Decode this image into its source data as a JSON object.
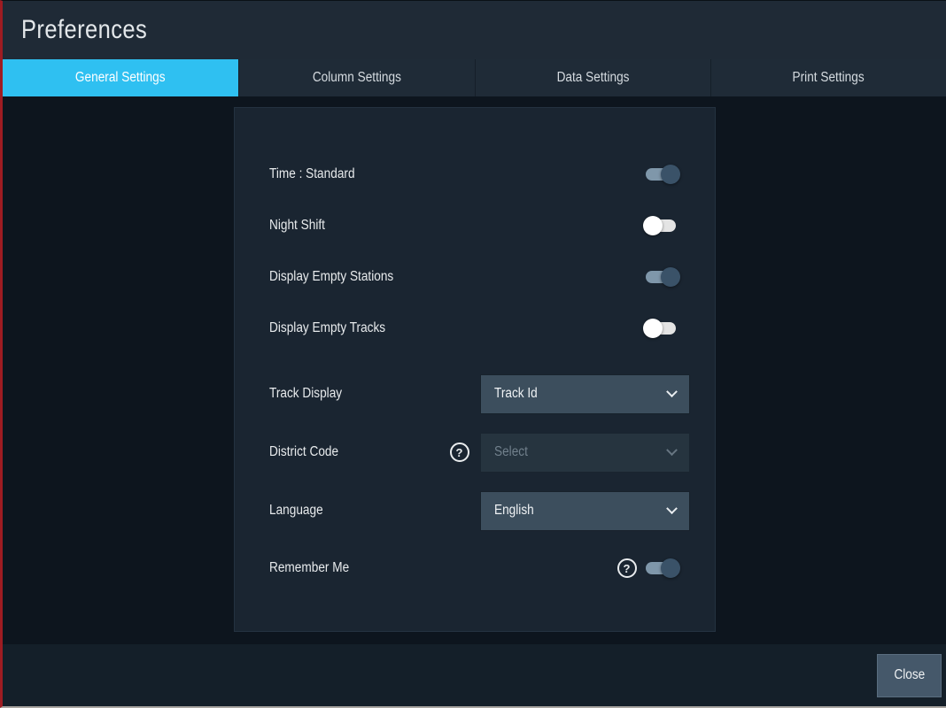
{
  "window": {
    "title": "Preferences"
  },
  "tabs": [
    {
      "label": "General Settings",
      "active": true
    },
    {
      "label": "Column Settings",
      "active": false
    },
    {
      "label": "Data Settings",
      "active": false
    },
    {
      "label": "Print Settings",
      "active": false
    }
  ],
  "settings": {
    "toggles": [
      {
        "label": "Time : Standard",
        "on": true
      },
      {
        "label": "Night Shift",
        "on": false
      },
      {
        "label": "Display Empty Stations",
        "on": true
      },
      {
        "label": "Display Empty Tracks",
        "on": false
      }
    ],
    "dropdowns": [
      {
        "label": "Track Display",
        "value": "Track Id",
        "disabled": false,
        "help": false
      },
      {
        "label": "District Code",
        "value": "Select",
        "disabled": true,
        "help": true
      },
      {
        "label": "Language",
        "value": "English",
        "disabled": false,
        "help": false
      }
    ],
    "remember": {
      "label": "Remember Me",
      "on": true,
      "help": true
    }
  },
  "help_icon": "?",
  "footer": {
    "close_label": "Close"
  },
  "colors": {
    "accent_tab": "#2fc0f1",
    "header_bg": "#1f2a36",
    "content_bg": "#0d151e",
    "panel_bg": "#1a2531",
    "select_bg": "#3c4e5d",
    "select_disabled_bg": "#26343f",
    "footer_bg": "#141f29",
    "close_bg": "#45586a",
    "toggle_on_track": "#7f97aa",
    "toggle_on_knob": "#3a5268",
    "toggle_off_track": "#e4e4e4",
    "toggle_off_knob": "#ffffff",
    "left_edge": "#9e1c22"
  }
}
